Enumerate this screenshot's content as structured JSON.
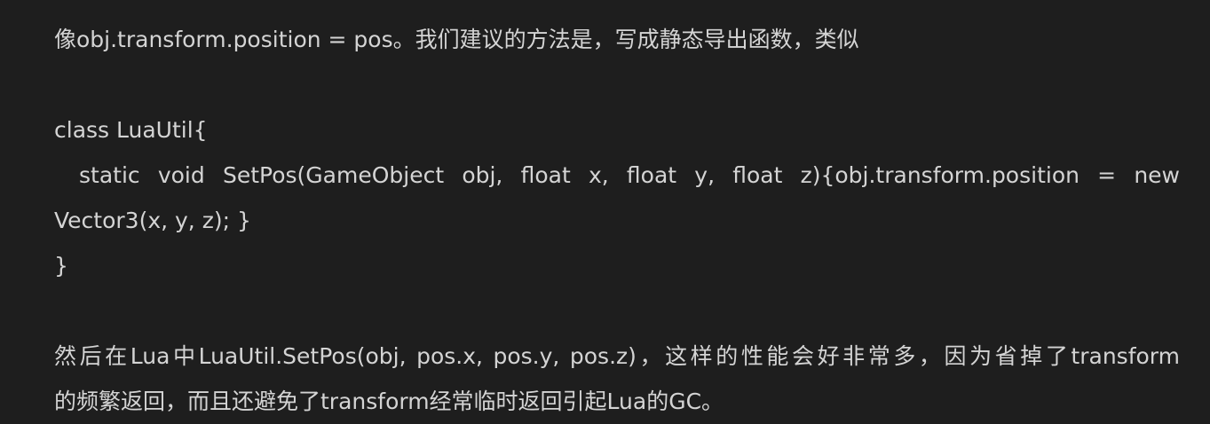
{
  "article": {
    "p1": "像obj.transform.position = pos。我们建议的方法是，写成静态导出函数，类似",
    "code": {
      "line1": "class LuaUtil{",
      "line2": "static void SetPos(GameObject obj, float x, float y, float z){obj.transform.position = new",
      "line3": "Vector3(x, y, z); }",
      "line4": "}"
    },
    "p2_line1": "然后在Lua中LuaUtil.SetPos(obj, pos.x, pos.y, pos.z)，这样的性能会好非常多，因为省掉了transform",
    "p2_line2": "的频繁返回，而且还避免了transform经常临时返回引起Lua的GC。"
  }
}
